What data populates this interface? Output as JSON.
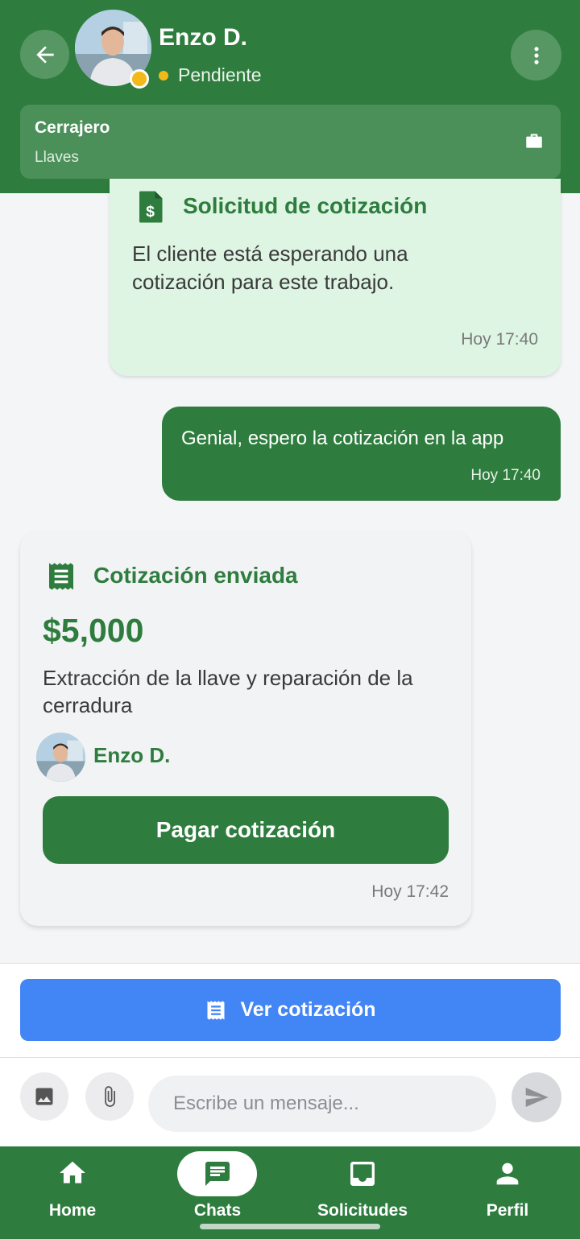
{
  "header": {
    "name": "Enzo D.",
    "status": "Pendiente",
    "status_color": "#f3b81a",
    "job_title": "Cerrajero",
    "job_subtitle": "Llaves"
  },
  "messages": {
    "request": {
      "title": "Solicitud de cotización",
      "body": "El cliente está esperando una cotización para este trabajo.",
      "time": "Hoy 17:40"
    },
    "outgoing": {
      "text": "Genial, espero la cotización en la app",
      "time": "Hoy 17:40"
    },
    "quote": {
      "title": "Cotización enviada",
      "amount": "$5,000",
      "description": "Extracción de la llave y reparación de la cerradura",
      "author": "Enzo D.",
      "pay_label": "Pagar cotización",
      "time": "Hoy 17:42"
    }
  },
  "actions": {
    "view_quote_label": "Ver cotización"
  },
  "composer": {
    "placeholder": "Escribe un mensaje..."
  },
  "nav": {
    "home": "Home",
    "chats": "Chats",
    "requests": "Solicitudes",
    "profile": "Perfil"
  },
  "colors": {
    "primary_green": "#2e7d3e",
    "accent_blue": "#4285f4",
    "request_bubble": "#def5e3"
  }
}
